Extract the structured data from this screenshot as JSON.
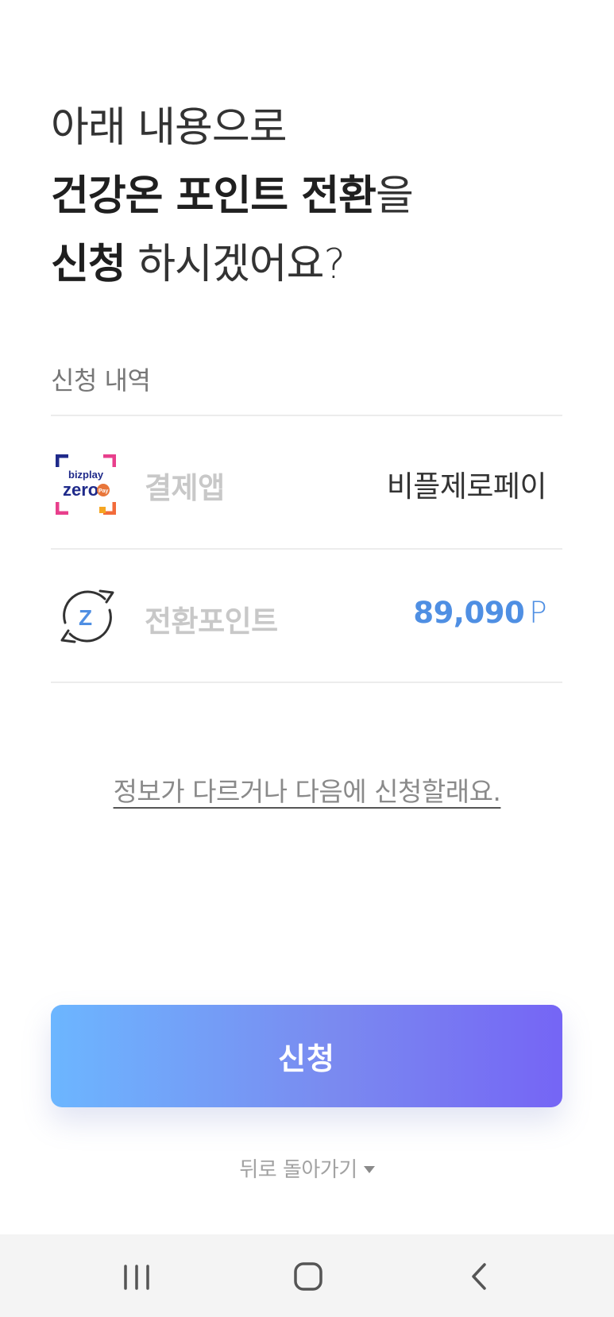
{
  "headline": {
    "line1": "아래 내용으로",
    "line2_bold": "건강온 포인트 전환",
    "line2_rest": "을",
    "line3_bold": "신청",
    "line3_rest": " 하시겠어요?"
  },
  "section": {
    "label": "신청 내역"
  },
  "rows": [
    {
      "icon": "bizplay-zero-pay-logo",
      "logo_text_top": "bizplay",
      "logo_text_main": "zero",
      "logo_text_badge": "Pay",
      "label": "결제앱",
      "value": "비플제로페이"
    },
    {
      "icon": "point-exchange-icon",
      "icon_letter": "Z",
      "label": "전환포인트",
      "value_number": "89,090",
      "value_unit": "P"
    }
  ],
  "alt_link": "정보가 다르거나 다음에 신청할래요.",
  "cta": {
    "label": "신청"
  },
  "back": {
    "label": "뒤로 돌아가기"
  },
  "colors": {
    "accent": "#4f8fe3",
    "cta_start": "#6cb6ff",
    "cta_end": "#7565f5",
    "logo_blue": "#1f2a8a",
    "logo_orange": "#f26b3a",
    "logo_pink": "#e83f8c"
  },
  "system_nav": {
    "recent": "recent-apps-icon",
    "home": "home-icon",
    "back": "back-icon"
  }
}
